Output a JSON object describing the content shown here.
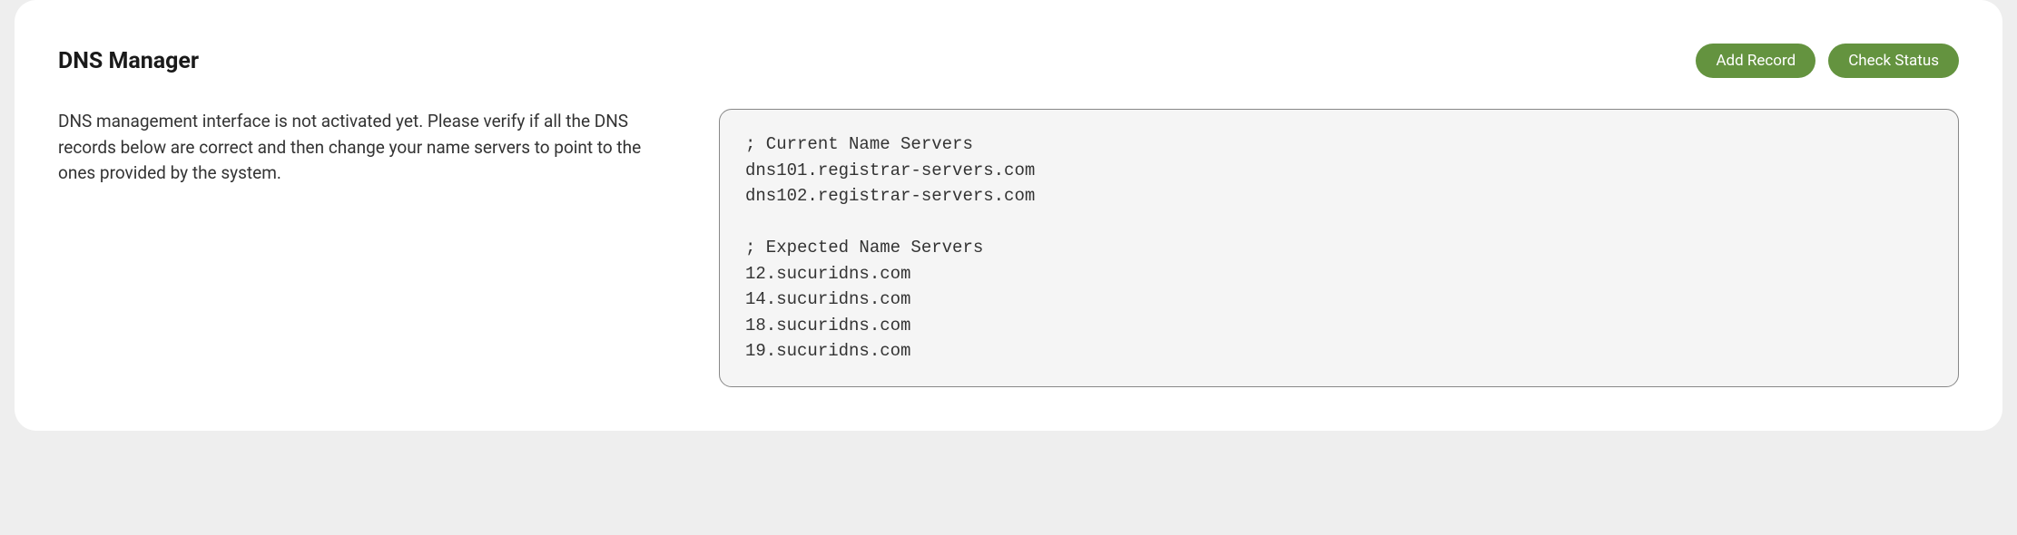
{
  "header": {
    "title": "DNS Manager",
    "buttons": {
      "add_record": "Add Record",
      "check_status": "Check Status"
    }
  },
  "main": {
    "description": "DNS management interface is not activated yet. Please verify if all the DNS records below are correct and then change your name servers to point to the ones provided by the system.",
    "code": "; Current Name Servers\ndns101.registrar-servers.com\ndns102.registrar-servers.com\n\n; Expected Name Servers\n12.sucuridns.com\n14.sucuridns.com\n18.sucuridns.com\n19.sucuridns.com"
  }
}
